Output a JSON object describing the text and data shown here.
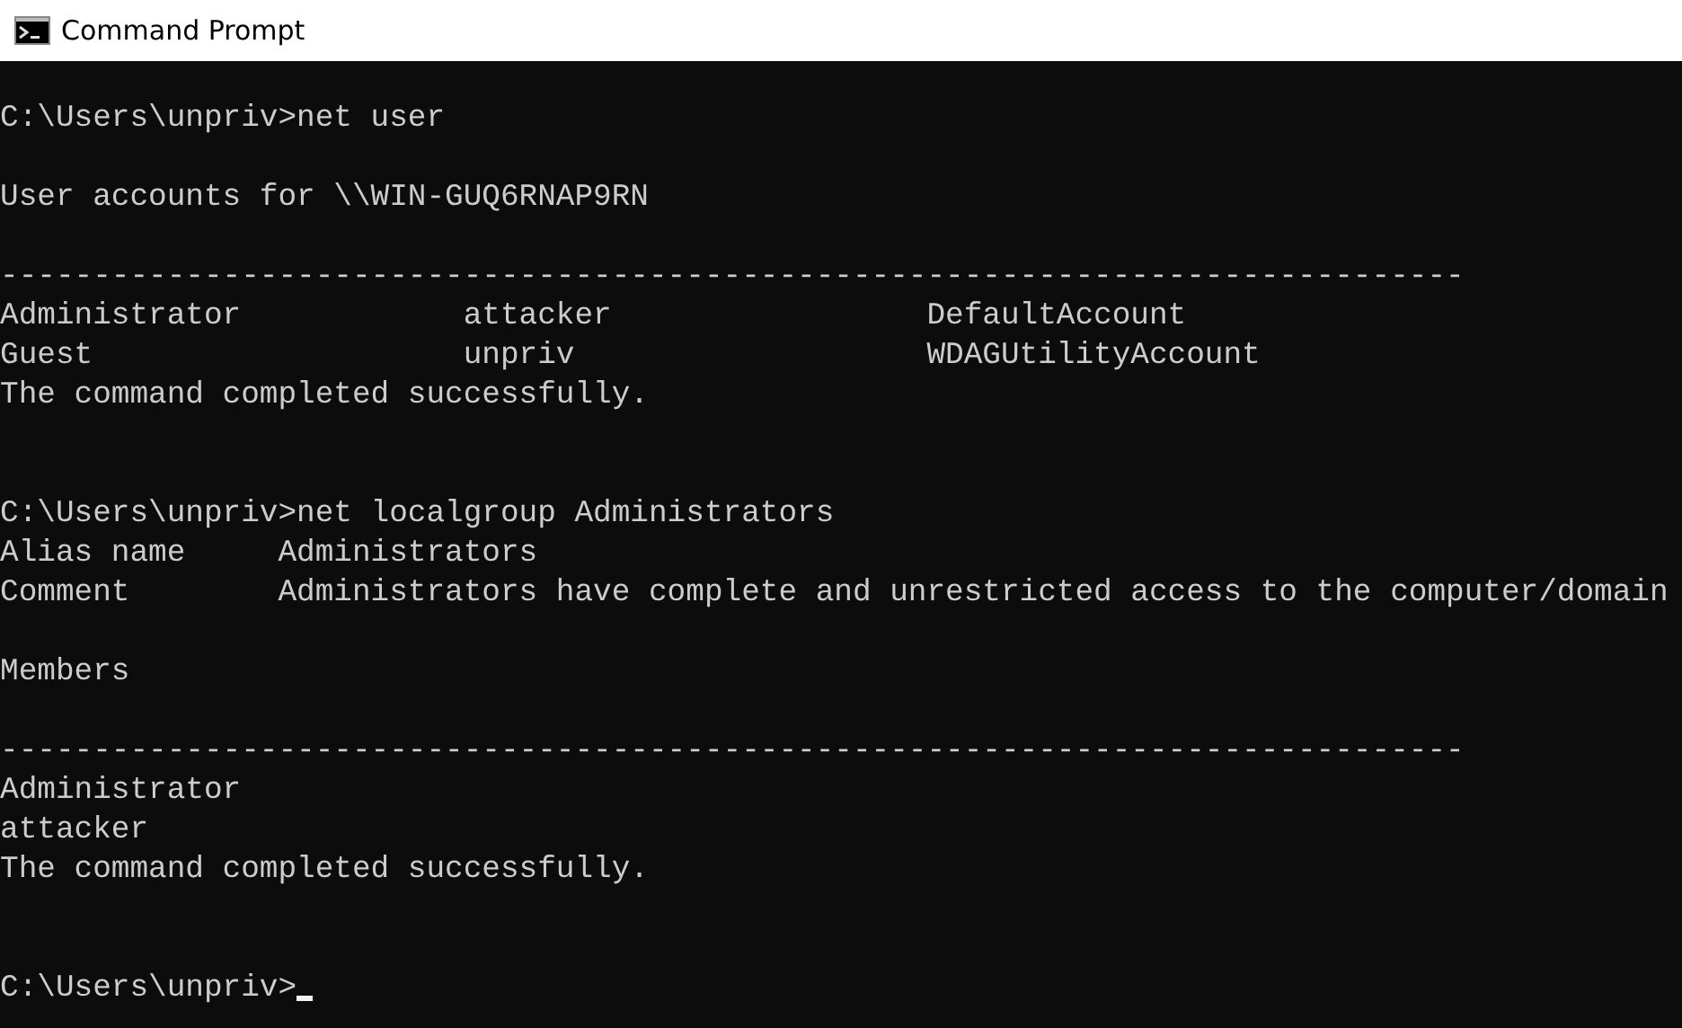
{
  "window": {
    "title": "Command Prompt"
  },
  "console": {
    "lines": [
      {
        "kind": "blank"
      },
      {
        "kind": "prompt",
        "text": "C:\\Users\\unpriv>net user",
        "cursor": false
      },
      {
        "kind": "blank"
      },
      {
        "kind": "output",
        "text": "User accounts for \\\\WIN-GUQ6RNAP9RN"
      },
      {
        "kind": "blank"
      },
      {
        "kind": "output",
        "text": "-------------------------------------------------------------------------------"
      },
      {
        "kind": "output",
        "text": "Administrator            attacker                 DefaultAccount"
      },
      {
        "kind": "output",
        "text": "Guest                    unpriv                   WDAGUtilityAccount"
      },
      {
        "kind": "output",
        "text": "The command completed successfully."
      },
      {
        "kind": "blank"
      },
      {
        "kind": "blank"
      },
      {
        "kind": "prompt",
        "text": "C:\\Users\\unpriv>net localgroup Administrators",
        "cursor": false
      },
      {
        "kind": "output",
        "text": "Alias name     Administrators"
      },
      {
        "kind": "output",
        "text": "Comment        Administrators have complete and unrestricted access to the computer/domain"
      },
      {
        "kind": "blank"
      },
      {
        "kind": "output",
        "text": "Members"
      },
      {
        "kind": "blank"
      },
      {
        "kind": "output",
        "text": "-------------------------------------------------------------------------------"
      },
      {
        "kind": "output",
        "text": "Administrator"
      },
      {
        "kind": "output",
        "text": "attacker"
      },
      {
        "kind": "output",
        "text": "The command completed successfully."
      },
      {
        "kind": "blank"
      },
      {
        "kind": "blank"
      },
      {
        "kind": "prompt",
        "text": "C:\\Users\\unpriv>",
        "cursor": true
      }
    ]
  }
}
